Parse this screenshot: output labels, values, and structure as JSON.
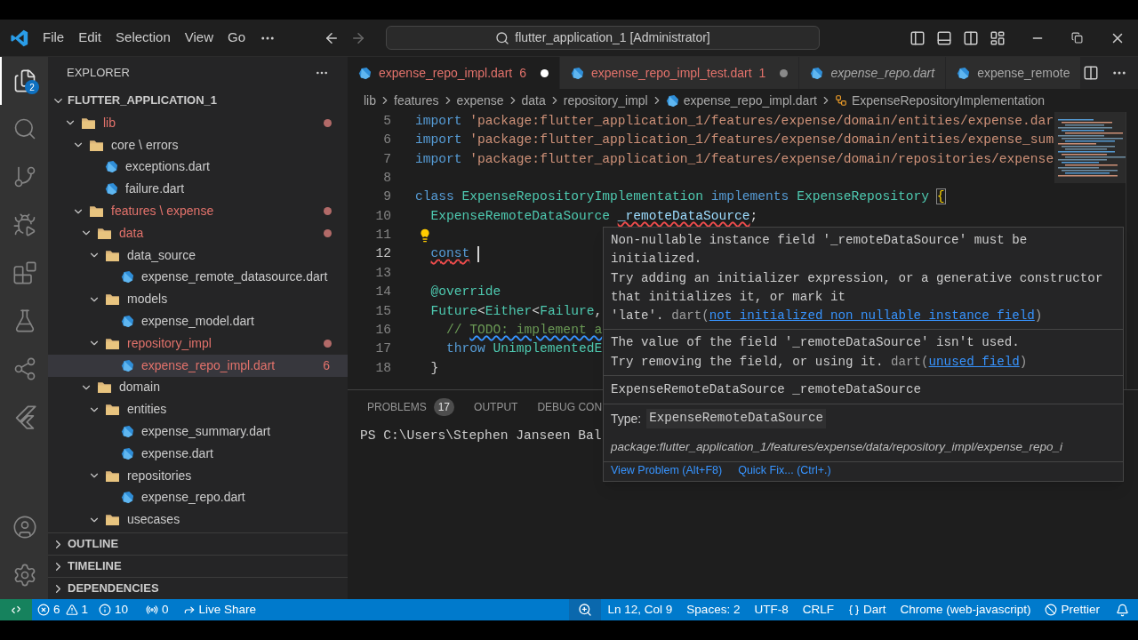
{
  "title_bar": {
    "menu": [
      "File",
      "Edit",
      "Selection",
      "View",
      "Go"
    ],
    "search": "flutter_application_1 [Administrator]"
  },
  "activity_bar": {
    "top": [
      {
        "kind": "explorer",
        "selected": true,
        "badge": "2"
      },
      {
        "kind": "search",
        "selected": false
      },
      {
        "kind": "source-control",
        "selected": false
      },
      {
        "kind": "run-debug",
        "selected": false
      },
      {
        "kind": "extensions",
        "selected": false
      },
      {
        "kind": "testing",
        "selected": false
      },
      {
        "kind": "live-share",
        "selected": false
      },
      {
        "kind": "flutter",
        "selected": false
      }
    ],
    "bottom": [
      {
        "kind": "account",
        "selected": false
      },
      {
        "kind": "settings",
        "selected": false
      }
    ]
  },
  "sidebar": {
    "title": "EXPLORER",
    "root": "FLUTTER_APPLICATION_1",
    "tree": [
      {
        "name": "lib",
        "kind": "folder",
        "expanded": true,
        "modified": true,
        "selected": false,
        "children": [
          {
            "name": "core \\ errors",
            "kind": "folder",
            "expanded": true,
            "modified": false,
            "selected": false,
            "children": [
              {
                "name": "exceptions.dart",
                "kind": "file",
                "modified": false,
                "selected": false
              },
              {
                "name": "failure.dart",
                "kind": "file",
                "modified": false,
                "selected": false
              }
            ]
          },
          {
            "name": "features \\ expense",
            "kind": "folder",
            "expanded": true,
            "modified": true,
            "selected": false,
            "children": [
              {
                "name": "data",
                "kind": "folder",
                "expanded": true,
                "modified": true,
                "selected": false,
                "children": [
                  {
                    "name": "data_source",
                    "kind": "folder",
                    "expanded": true,
                    "modified": false,
                    "selected": false,
                    "children": [
                      {
                        "name": "expense_remote_datasource.dart",
                        "kind": "file",
                        "modified": false,
                        "selected": false
                      }
                    ]
                  },
                  {
                    "name": "models",
                    "kind": "folder",
                    "expanded": true,
                    "modified": false,
                    "selected": false,
                    "children": [
                      {
                        "name": "expense_model.dart",
                        "kind": "file",
                        "modified": false,
                        "selected": false
                      }
                    ]
                  },
                  {
                    "name": "repository_impl",
                    "kind": "folder",
                    "expanded": true,
                    "modified": true,
                    "selected": false,
                    "children": [
                      {
                        "name": "expense_repo_impl.dart",
                        "kind": "file",
                        "modified": true,
                        "selected": true,
                        "badge": "6"
                      }
                    ]
                  }
                ]
              },
              {
                "name": "domain",
                "kind": "folder",
                "expanded": true,
                "modified": false,
                "selected": false,
                "children": [
                  {
                    "name": "entities",
                    "kind": "folder",
                    "expanded": true,
                    "modified": false,
                    "selected": false,
                    "children": [
                      {
                        "name": "expense_summary.dart",
                        "kind": "file",
                        "modified": false,
                        "selected": false
                      },
                      {
                        "name": "expense.dart",
                        "kind": "file",
                        "modified": false,
                        "selected": false
                      }
                    ]
                  },
                  {
                    "name": "repositories",
                    "kind": "folder",
                    "expanded": true,
                    "modified": false,
                    "selected": false,
                    "children": [
                      {
                        "name": "expense_repo.dart",
                        "kind": "file",
                        "modified": false,
                        "selected": false
                      }
                    ]
                  },
                  {
                    "name": "usecases",
                    "kind": "folder",
                    "expanded": true,
                    "modified": false,
                    "selected": false
                  }
                ]
              }
            ]
          }
        ]
      }
    ],
    "sections": [
      {
        "title": "OUTLINE",
        "expanded": false
      },
      {
        "title": "TIMELINE",
        "expanded": false
      },
      {
        "title": "DEPENDENCIES",
        "expanded": false
      }
    ]
  },
  "tabs": [
    {
      "label": "expense_repo_impl.dart",
      "badge": "6",
      "modified": true,
      "dirty": true,
      "preview": false,
      "selected": true
    },
    {
      "label": "expense_repo_impl_test.dart",
      "badge": "1",
      "modified": true,
      "dirty": true,
      "preview": false,
      "selected": false
    },
    {
      "label": "expense_repo.dart",
      "modified": false,
      "dirty": false,
      "preview": true,
      "selected": false
    },
    {
      "label": "expense_remote",
      "modified": false,
      "dirty": false,
      "preview": false,
      "selected": false
    }
  ],
  "breadcrumbs": [
    {
      "kind": "folder",
      "text": "lib"
    },
    {
      "kind": "folder",
      "text": "features"
    },
    {
      "kind": "folder",
      "text": "expense"
    },
    {
      "kind": "folder",
      "text": "data"
    },
    {
      "kind": "folder",
      "text": "repository_impl"
    },
    {
      "kind": "file",
      "text": "expense_repo_impl.dart"
    },
    {
      "kind": "class",
      "text": "ExpenseRepositoryImplementation"
    }
  ],
  "code": [
    {
      "number": "5",
      "tokens": [
        {
          "kind": "keyword",
          "text": "import "
        },
        {
          "kind": "string",
          "text": "'package:flutter_application_1/features/expense/domain/entities/expense.dar"
        }
      ]
    },
    {
      "number": "6",
      "tokens": [
        {
          "kind": "keyword",
          "text": "import "
        },
        {
          "kind": "string",
          "text": "'package:flutter_application_1/features/expense/domain/entities/expense_sum"
        }
      ]
    },
    {
      "number": "7",
      "tokens": [
        {
          "kind": "keyword",
          "text": "import "
        },
        {
          "kind": "string",
          "text": "'package:flutter_application_1/features/expense/domain/repositories/expense"
        }
      ]
    },
    {
      "number": "8"
    },
    {
      "number": "9",
      "tokens": [
        {
          "kind": "keyword",
          "text": "class "
        },
        {
          "kind": "type",
          "text": "ExpenseRepositoryImplementation "
        },
        {
          "kind": "keyword",
          "text": "implements "
        },
        {
          "kind": "type",
          "text": "ExpenseRepository "
        },
        {
          "kind": "bracket",
          "text": "{"
        }
      ]
    },
    {
      "number": "10",
      "indented": true,
      "tokens": [
        {
          "kind": "type",
          "text": "ExpenseRemoteDataSource "
        },
        {
          "kind": "field",
          "text": "_remoteDataSource",
          "error": true
        },
        {
          "kind": "plain",
          "text": ";"
        }
      ]
    },
    {
      "number": "11",
      "lightbulb": true
    },
    {
      "number": "12",
      "indented": true,
      "current": true,
      "cursor": true,
      "tokens": [
        {
          "kind": "keyword",
          "text": "const",
          "error": true
        }
      ]
    },
    {
      "number": "13"
    },
    {
      "number": "14",
      "indented": true,
      "tokens": [
        {
          "kind": "annotation",
          "text": "@override"
        }
      ]
    },
    {
      "number": "15",
      "indented": true,
      "tokens": [
        {
          "kind": "type",
          "text": "Future"
        },
        {
          "kind": "plain",
          "text": "<"
        },
        {
          "kind": "type",
          "text": "Either"
        },
        {
          "kind": "plain",
          "text": "<"
        },
        {
          "kind": "type",
          "text": "Failure"
        },
        {
          "kind": "plain",
          "text": ","
        }
      ]
    },
    {
      "number": "16",
      "indented": true,
      "nested": true,
      "tokens": [
        {
          "kind": "comment",
          "text": "// "
        },
        {
          "kind": "comment",
          "text": "TODO: implement a",
          "info": true
        }
      ]
    },
    {
      "number": "17",
      "indented": true,
      "nested": true,
      "tokens": [
        {
          "kind": "keyword",
          "text": "throw "
        },
        {
          "kind": "type",
          "text": "UnimplementedE"
        }
      ]
    },
    {
      "number": "18",
      "indented": true,
      "tokens": [
        {
          "kind": "plain",
          "text": "}"
        }
      ]
    }
  ],
  "panel": {
    "tabs": [
      {
        "label": "PROBLEMS",
        "badge": "17",
        "selected": false
      },
      {
        "label": "OUTPUT",
        "selected": false
      },
      {
        "label": "DEBUG CON",
        "selected": false
      }
    ],
    "terminal": "PS C:\\Users\\Stephen Janseen Bal"
  },
  "hover": {
    "problems": [
      {
        "lines": [
          "Non-nullable instance field '_remoteDataSource' must be",
          "initialized.",
          "Try adding an initializer expression, or a generative constructor",
          "that initializes it, or mark it",
          "'late'."
        ],
        "source": "dart(",
        "code": "not_initialized_non_nullable_instance_field",
        "source_end": ")"
      },
      {
        "lines": [
          "The value of the field '_remoteDataSource' isn't used.",
          "Try removing the field, or using it."
        ],
        "source": "dart(",
        "code": "unused_field",
        "source_end": ")"
      }
    ],
    "signature": "ExpenseRemoteDataSource _remoteDataSource",
    "type_label": "Type:",
    "type_value": "ExpenseRemoteDataSource",
    "path": "package:flutter_application_1/features/expense/data/repository_impl/expense_repo_i",
    "actions": [
      "View Problem (Alt+F8)",
      "Quick Fix... (Ctrl+.)"
    ]
  },
  "status_bar": {
    "left": [
      {
        "kind": "remote"
      },
      {
        "kind": "errors",
        "text": "6"
      },
      {
        "kind": "warnings",
        "text": "1"
      },
      {
        "kind": "infos",
        "text": "10"
      },
      {
        "kind": "ports",
        "text": "0"
      },
      {
        "kind": "liveshare",
        "text": "Live Share"
      }
    ],
    "right": [
      {
        "kind": "zoom"
      },
      {
        "kind": "text",
        "text": "Ln 12, Col 9"
      },
      {
        "kind": "text",
        "text": "Spaces: 2"
      },
      {
        "kind": "text",
        "text": "UTF-8"
      },
      {
        "kind": "text",
        "text": "CRLF"
      },
      {
        "kind": "language",
        "text": "Dart"
      },
      {
        "kind": "text",
        "text": "Chrome (web-javascript)"
      },
      {
        "kind": "prettier",
        "text": "Prettier"
      },
      {
        "kind": "bell"
      }
    ]
  }
}
